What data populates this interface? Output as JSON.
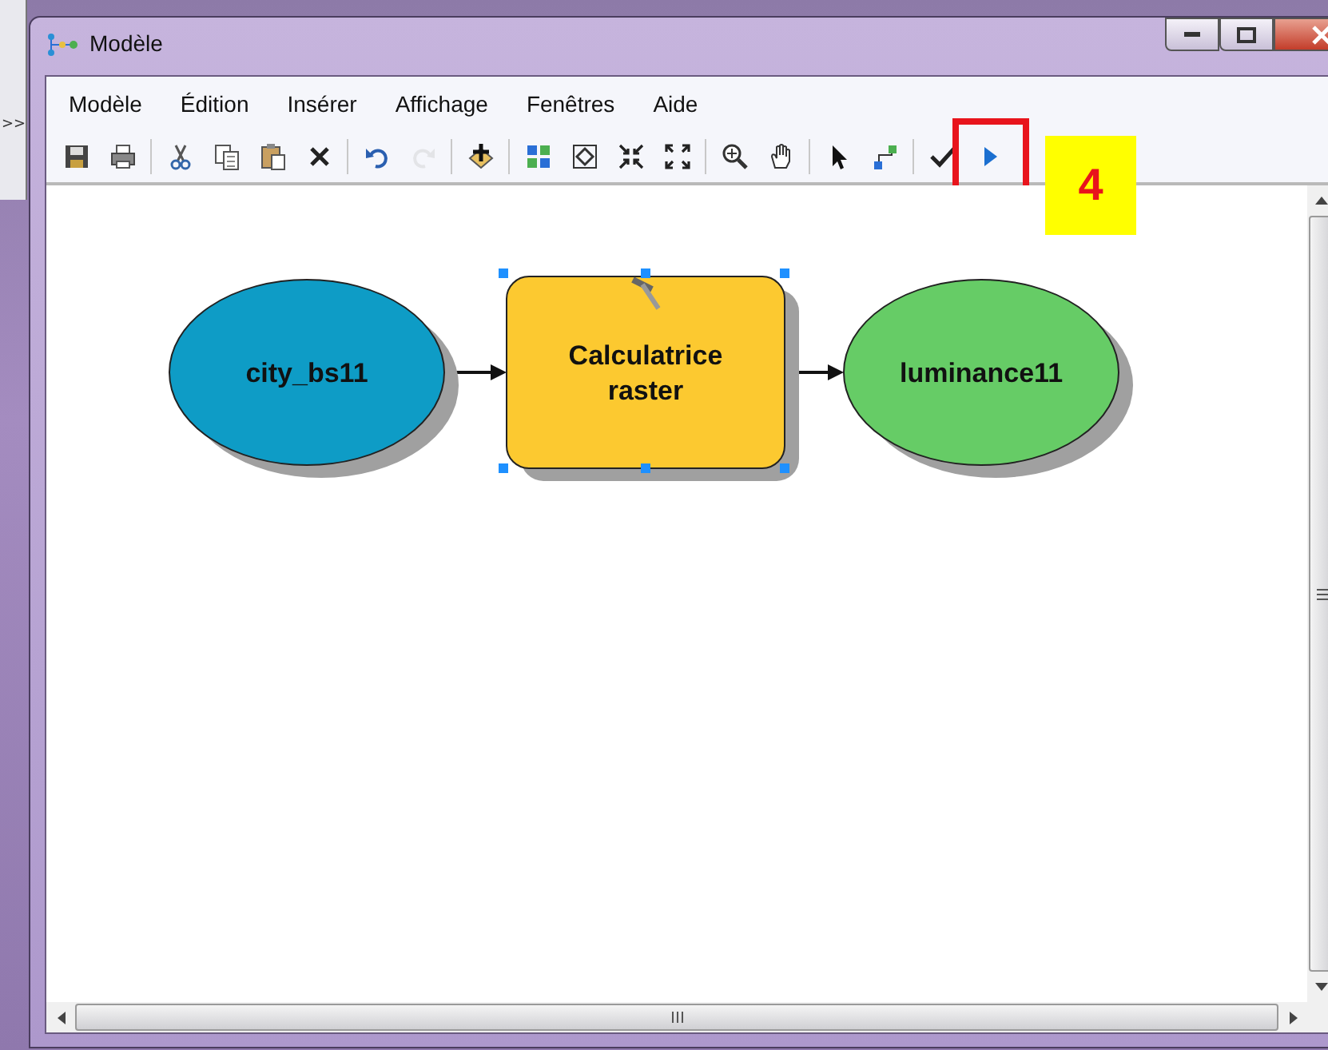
{
  "background_window": {
    "text": ">>"
  },
  "window": {
    "title": "Modèle"
  },
  "menu": [
    "Modèle",
    "Édition",
    "Insérer",
    "Affichage",
    "Fenêtres",
    "Aide"
  ],
  "toolbar": [
    {
      "kind": "save",
      "disabled": false
    },
    {
      "kind": "print",
      "disabled": false
    },
    {
      "kind": "separator"
    },
    {
      "kind": "cut",
      "disabled": false
    },
    {
      "kind": "copy",
      "disabled": false
    },
    {
      "kind": "paste",
      "disabled": false
    },
    {
      "kind": "delete",
      "disabled": false
    },
    {
      "kind": "separator"
    },
    {
      "kind": "undo",
      "disabled": false
    },
    {
      "kind": "redo",
      "disabled": true
    },
    {
      "kind": "separator"
    },
    {
      "kind": "add",
      "disabled": false
    },
    {
      "kind": "separator"
    },
    {
      "kind": "grid",
      "disabled": false
    },
    {
      "kind": "fit",
      "disabled": false
    },
    {
      "kind": "shrink",
      "disabled": false
    },
    {
      "kind": "expand",
      "disabled": false
    },
    {
      "kind": "separator"
    },
    {
      "kind": "zoom",
      "disabled": false
    },
    {
      "kind": "pan",
      "disabled": false
    },
    {
      "kind": "separator"
    },
    {
      "kind": "select",
      "disabled": false
    },
    {
      "kind": "connect",
      "disabled": false
    },
    {
      "kind": "separator"
    },
    {
      "kind": "validate",
      "disabled": false
    },
    {
      "kind": "run",
      "disabled": false,
      "highlighted": true
    }
  ],
  "diagram": {
    "nodes": [
      {
        "kind": "data",
        "label": "city_bs11",
        "color": "#0e9cc6",
        "selected": false
      },
      {
        "kind": "tool",
        "label": "Calculatrice raster",
        "color": "#fcc930",
        "selected": true
      },
      {
        "kind": "data",
        "label": "luminance11",
        "color": "#66cc66",
        "selected": false
      }
    ]
  },
  "callout": {
    "text": "4"
  }
}
